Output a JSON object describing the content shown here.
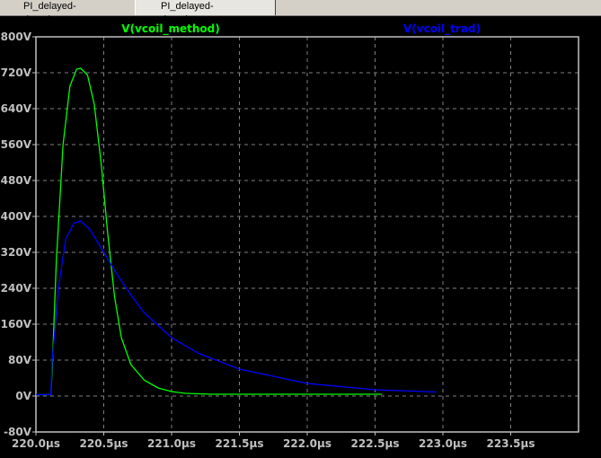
{
  "tabs": [
    {
      "label": "PI_delayed-damping.asc"
    },
    {
      "label": "PI_delayed-damping.raw",
      "active": true
    }
  ],
  "chart_data": {
    "type": "line",
    "xlabel": "",
    "ylabel": "",
    "xlim": [
      220.0,
      224.0
    ],
    "ylim": [
      -80,
      800
    ],
    "grid": true,
    "xticks": [
      220.0,
      220.5,
      221.0,
      221.5,
      222.0,
      222.5,
      223.0,
      223.5
    ],
    "xtick_labels": [
      "220.0µs",
      "220.5µs",
      "221.0µs",
      "221.5µs",
      "222.0µs",
      "222.5µs",
      "223.0µs",
      "223.5µs"
    ],
    "yticks": [
      -80,
      0,
      80,
      160,
      240,
      320,
      400,
      480,
      560,
      640,
      720,
      800
    ],
    "ytick_labels": [
      "-80V",
      "0V",
      "80V",
      "160V",
      "240V",
      "320V",
      "400V",
      "480V",
      "560V",
      "640V",
      "720V",
      "800V"
    ],
    "series": [
      {
        "name": "V(vcoil_method)",
        "color": "#00ff00",
        "x": [
          220.0,
          220.11,
          220.12,
          220.15,
          220.2,
          220.25,
          220.3,
          220.33,
          220.38,
          220.43,
          220.48,
          220.53,
          220.58,
          220.63,
          220.7,
          220.8,
          220.9,
          221.0,
          221.1,
          221.3,
          222.55
        ],
        "y": [
          3,
          3,
          60,
          300,
          560,
          690,
          728,
          730,
          715,
          650,
          520,
          360,
          220,
          130,
          70,
          35,
          18,
          10,
          6,
          4,
          4
        ]
      },
      {
        "name": "V(vcoil_trad)",
        "color": "#0000ff",
        "x": [
          220.0,
          220.11,
          220.12,
          220.17,
          220.22,
          220.28,
          220.33,
          220.4,
          220.5,
          220.6,
          220.7,
          220.8,
          221.0,
          221.2,
          221.5,
          222.0,
          222.5,
          222.95
        ],
        "y": [
          3,
          3,
          80,
          250,
          350,
          385,
          390,
          370,
          320,
          270,
          225,
          185,
          130,
          95,
          60,
          28,
          14,
          9
        ]
      }
    ]
  }
}
